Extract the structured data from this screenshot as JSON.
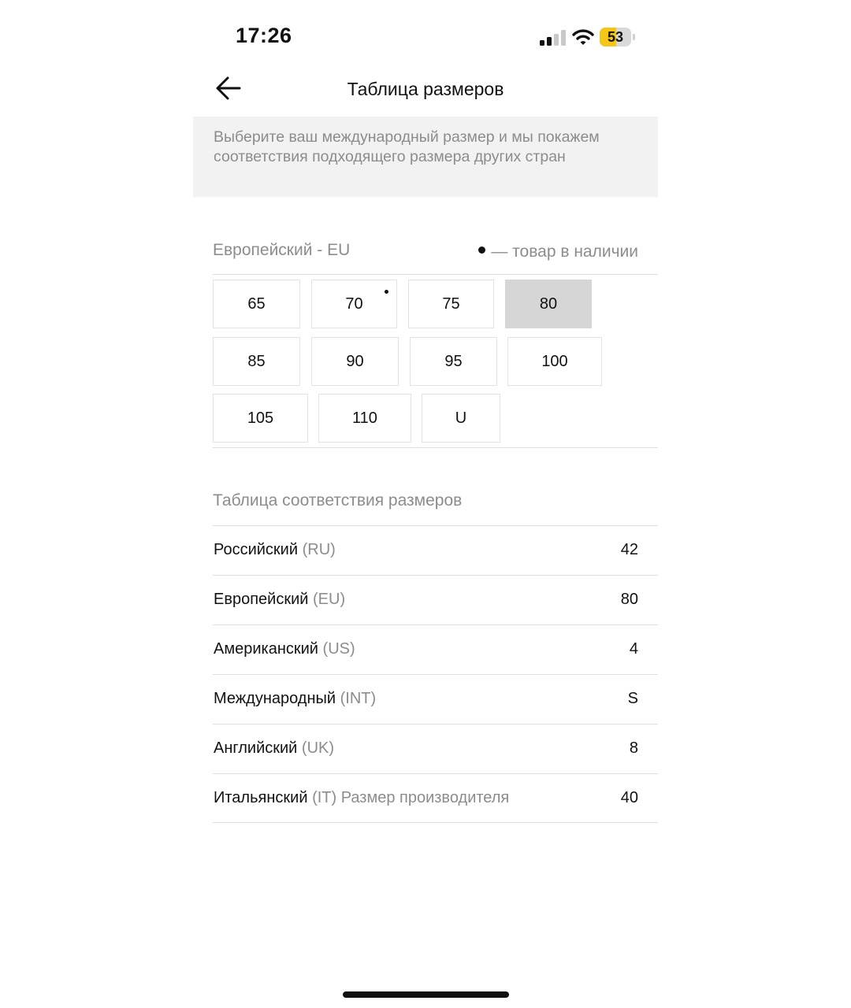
{
  "status_bar": {
    "time": "17:26",
    "battery_level": "53",
    "battery_fraction": 0.53,
    "battery_color": "#f5c518",
    "signal_bars_active": 2,
    "signal_bars_total": 4,
    "icons": [
      "signal-icon",
      "wifi-icon",
      "battery-icon"
    ]
  },
  "header": {
    "back_icon": "arrow-left-icon",
    "title": "Таблица размеров"
  },
  "info": {
    "text": "Выберите ваш международный размер и мы покажем соответствия подходящего размера других стран"
  },
  "size_section": {
    "system_label": "Европейский - EU",
    "legend_text": "— товар в наличии",
    "sizes": [
      {
        "label": "65",
        "available": false,
        "selected": false
      },
      {
        "label": "70",
        "available": true,
        "selected": false
      },
      {
        "label": "75",
        "available": false,
        "selected": false
      },
      {
        "label": "80",
        "available": false,
        "selected": true
      },
      {
        "label": "85",
        "available": false,
        "selected": false
      },
      {
        "label": "90",
        "available": false,
        "selected": false
      },
      {
        "label": "95",
        "available": false,
        "selected": false
      },
      {
        "label": "100",
        "available": false,
        "selected": false
      },
      {
        "label": "105",
        "available": false,
        "selected": false
      },
      {
        "label": "110",
        "available": false,
        "selected": false
      },
      {
        "label": "U",
        "available": false,
        "selected": false
      }
    ]
  },
  "correspondence": {
    "title": "Таблица соответствия размеров",
    "rows": [
      {
        "name": "Российский",
        "code": "(RU)",
        "note": "",
        "value": "42"
      },
      {
        "name": "Европейский",
        "code": "(EU)",
        "note": "",
        "value": "80"
      },
      {
        "name": "Американский",
        "code": "(US)",
        "note": "",
        "value": "4"
      },
      {
        "name": "Международный",
        "code": "(INT)",
        "note": "",
        "value": "S"
      },
      {
        "name": "Английский",
        "code": "(UK)",
        "note": "",
        "value": "8"
      },
      {
        "name": "Итальянский",
        "code": "(IT)",
        "note": "Размер производителя",
        "value": "40"
      }
    ]
  }
}
